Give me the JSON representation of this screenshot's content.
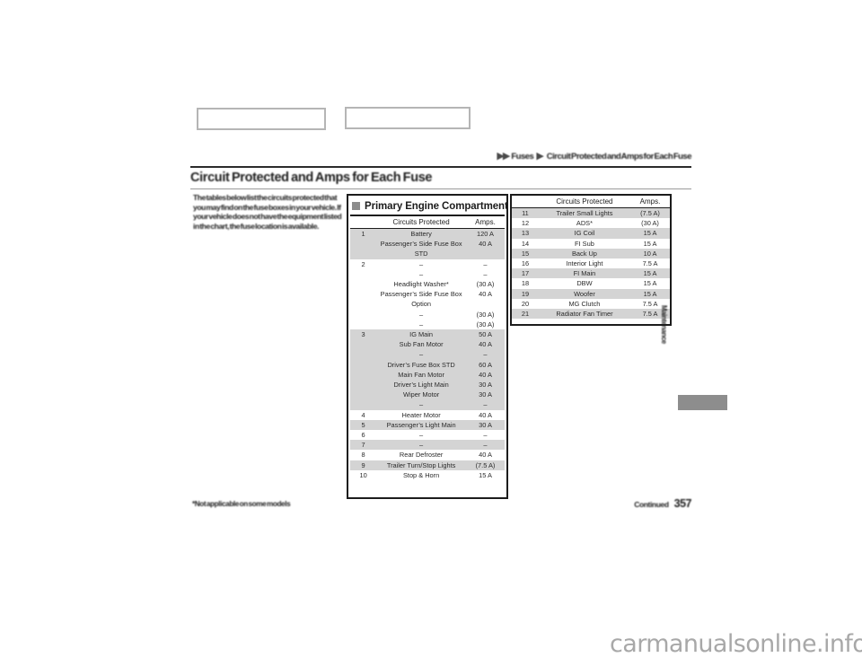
{
  "breadcrumb": {
    "arrows": "▶▶",
    "separator": "▶",
    "section": "Fuses",
    "subsection": "Circuit Protected and Amps for Each Fuse"
  },
  "section_title": "Circuit Protected and Amps for Each Fuse",
  "intro_paragraph": "The tables below list the circuits protected that you may find on the fuse boxes in your vehicle. If your vehicle does not have the equipment listed in the chart, the fuse location is available.",
  "footnote": "*Not applicable on some models",
  "page_footer": {
    "label": "Continued",
    "page_number": "357"
  },
  "side_tab": {
    "label": "Maintenance"
  },
  "watermark": "carmanualsonline.info",
  "image_placeholders": [
    {
      "name": "fuse-box-diagram-left"
    },
    {
      "name": "fuse-box-diagram-right"
    }
  ],
  "left_table": {
    "heading": "Primary Engine Compartment",
    "bullet_icon": "square-bullet-icon",
    "columns": [
      "",
      "Circuits Protected",
      "Amps."
    ],
    "rows": [
      {
        "num": "1",
        "name": "Battery",
        "amps": "120 A",
        "shade": true
      },
      {
        "num": "",
        "name": "Passenger’s Side Fuse Box",
        "amps": "40 A",
        "shade": true
      },
      {
        "num": "",
        "name": "STD",
        "amps": "",
        "shade": true
      },
      {
        "num": "2",
        "name": "–",
        "amps": "–",
        "shade": false
      },
      {
        "num": "",
        "name": "–",
        "amps": "–",
        "shade": false
      },
      {
        "num": "",
        "name": "Headlight Washer*",
        "amps": "(30 A)",
        "shade": false
      },
      {
        "num": "",
        "name": "Passenger’s Side Fuse Box",
        "amps": "40 A",
        "shade": false
      },
      {
        "num": "",
        "name": "Option",
        "amps": "",
        "shade": false
      },
      {
        "num": "",
        "name": "–",
        "amps": "(30 A)",
        "shade": false
      },
      {
        "num": "",
        "name": "–",
        "amps": "(30 A)",
        "shade": false
      },
      {
        "num": "3",
        "name": "IG Main",
        "amps": "50 A",
        "shade": true
      },
      {
        "num": "",
        "name": "Sub Fan Motor",
        "amps": "40 A",
        "shade": true
      },
      {
        "num": "",
        "name": "–",
        "amps": "–",
        "shade": true
      },
      {
        "num": "",
        "name": "Driver’s Fuse Box STD",
        "amps": "60 A",
        "shade": true
      },
      {
        "num": "",
        "name": "Main Fan Motor",
        "amps": "40 A",
        "shade": true
      },
      {
        "num": "",
        "name": "Driver’s Light Main",
        "amps": "30 A",
        "shade": true
      },
      {
        "num": "",
        "name": "Wiper Motor",
        "amps": "30 A",
        "shade": true
      },
      {
        "num": "",
        "name": "–",
        "amps": "–",
        "shade": true
      },
      {
        "num": "4",
        "name": "Heater Motor",
        "amps": "40 A",
        "shade": false
      },
      {
        "num": "5",
        "name": "Passenger’s Light Main",
        "amps": "30 A",
        "shade": true
      },
      {
        "num": "6",
        "name": "–",
        "amps": "–",
        "shade": false
      },
      {
        "num": "7",
        "name": "–",
        "amps": "–",
        "shade": true
      },
      {
        "num": "8",
        "name": "Rear Defroster",
        "amps": "40 A",
        "shade": false
      },
      {
        "num": "9",
        "name": "Trailer Turn/Stop Lights",
        "amps": "(7.5 A)",
        "shade": true
      },
      {
        "num": "10",
        "name": "Stop & Horn",
        "amps": "15 A",
        "shade": false
      }
    ]
  },
  "right_table": {
    "columns": [
      "",
      "Circuits Protected",
      "Amps."
    ],
    "rows": [
      {
        "num": "11",
        "name": "Trailer Small Lights",
        "amps": "(7.5 A)",
        "shade": true
      },
      {
        "num": "12",
        "name": "ADS*",
        "amps": "(30 A)",
        "shade": false
      },
      {
        "num": "13",
        "name": "IG Coil",
        "amps": "15 A",
        "shade": true
      },
      {
        "num": "14",
        "name": "FI Sub",
        "amps": "15 A",
        "shade": false
      },
      {
        "num": "15",
        "name": "Back Up",
        "amps": "10 A",
        "shade": true
      },
      {
        "num": "16",
        "name": "Interior Light",
        "amps": "7.5 A",
        "shade": false
      },
      {
        "num": "17",
        "name": "FI Main",
        "amps": "15 A",
        "shade": true
      },
      {
        "num": "18",
        "name": "DBW",
        "amps": "15 A",
        "shade": false
      },
      {
        "num": "19",
        "name": "Woofer",
        "amps": "15 A",
        "shade": true
      },
      {
        "num": "20",
        "name": "MG Clutch",
        "amps": "7.5 A",
        "shade": false
      },
      {
        "num": "21",
        "name": "Radiator Fan Timer",
        "amps": "7.5 A",
        "shade": true
      }
    ]
  }
}
